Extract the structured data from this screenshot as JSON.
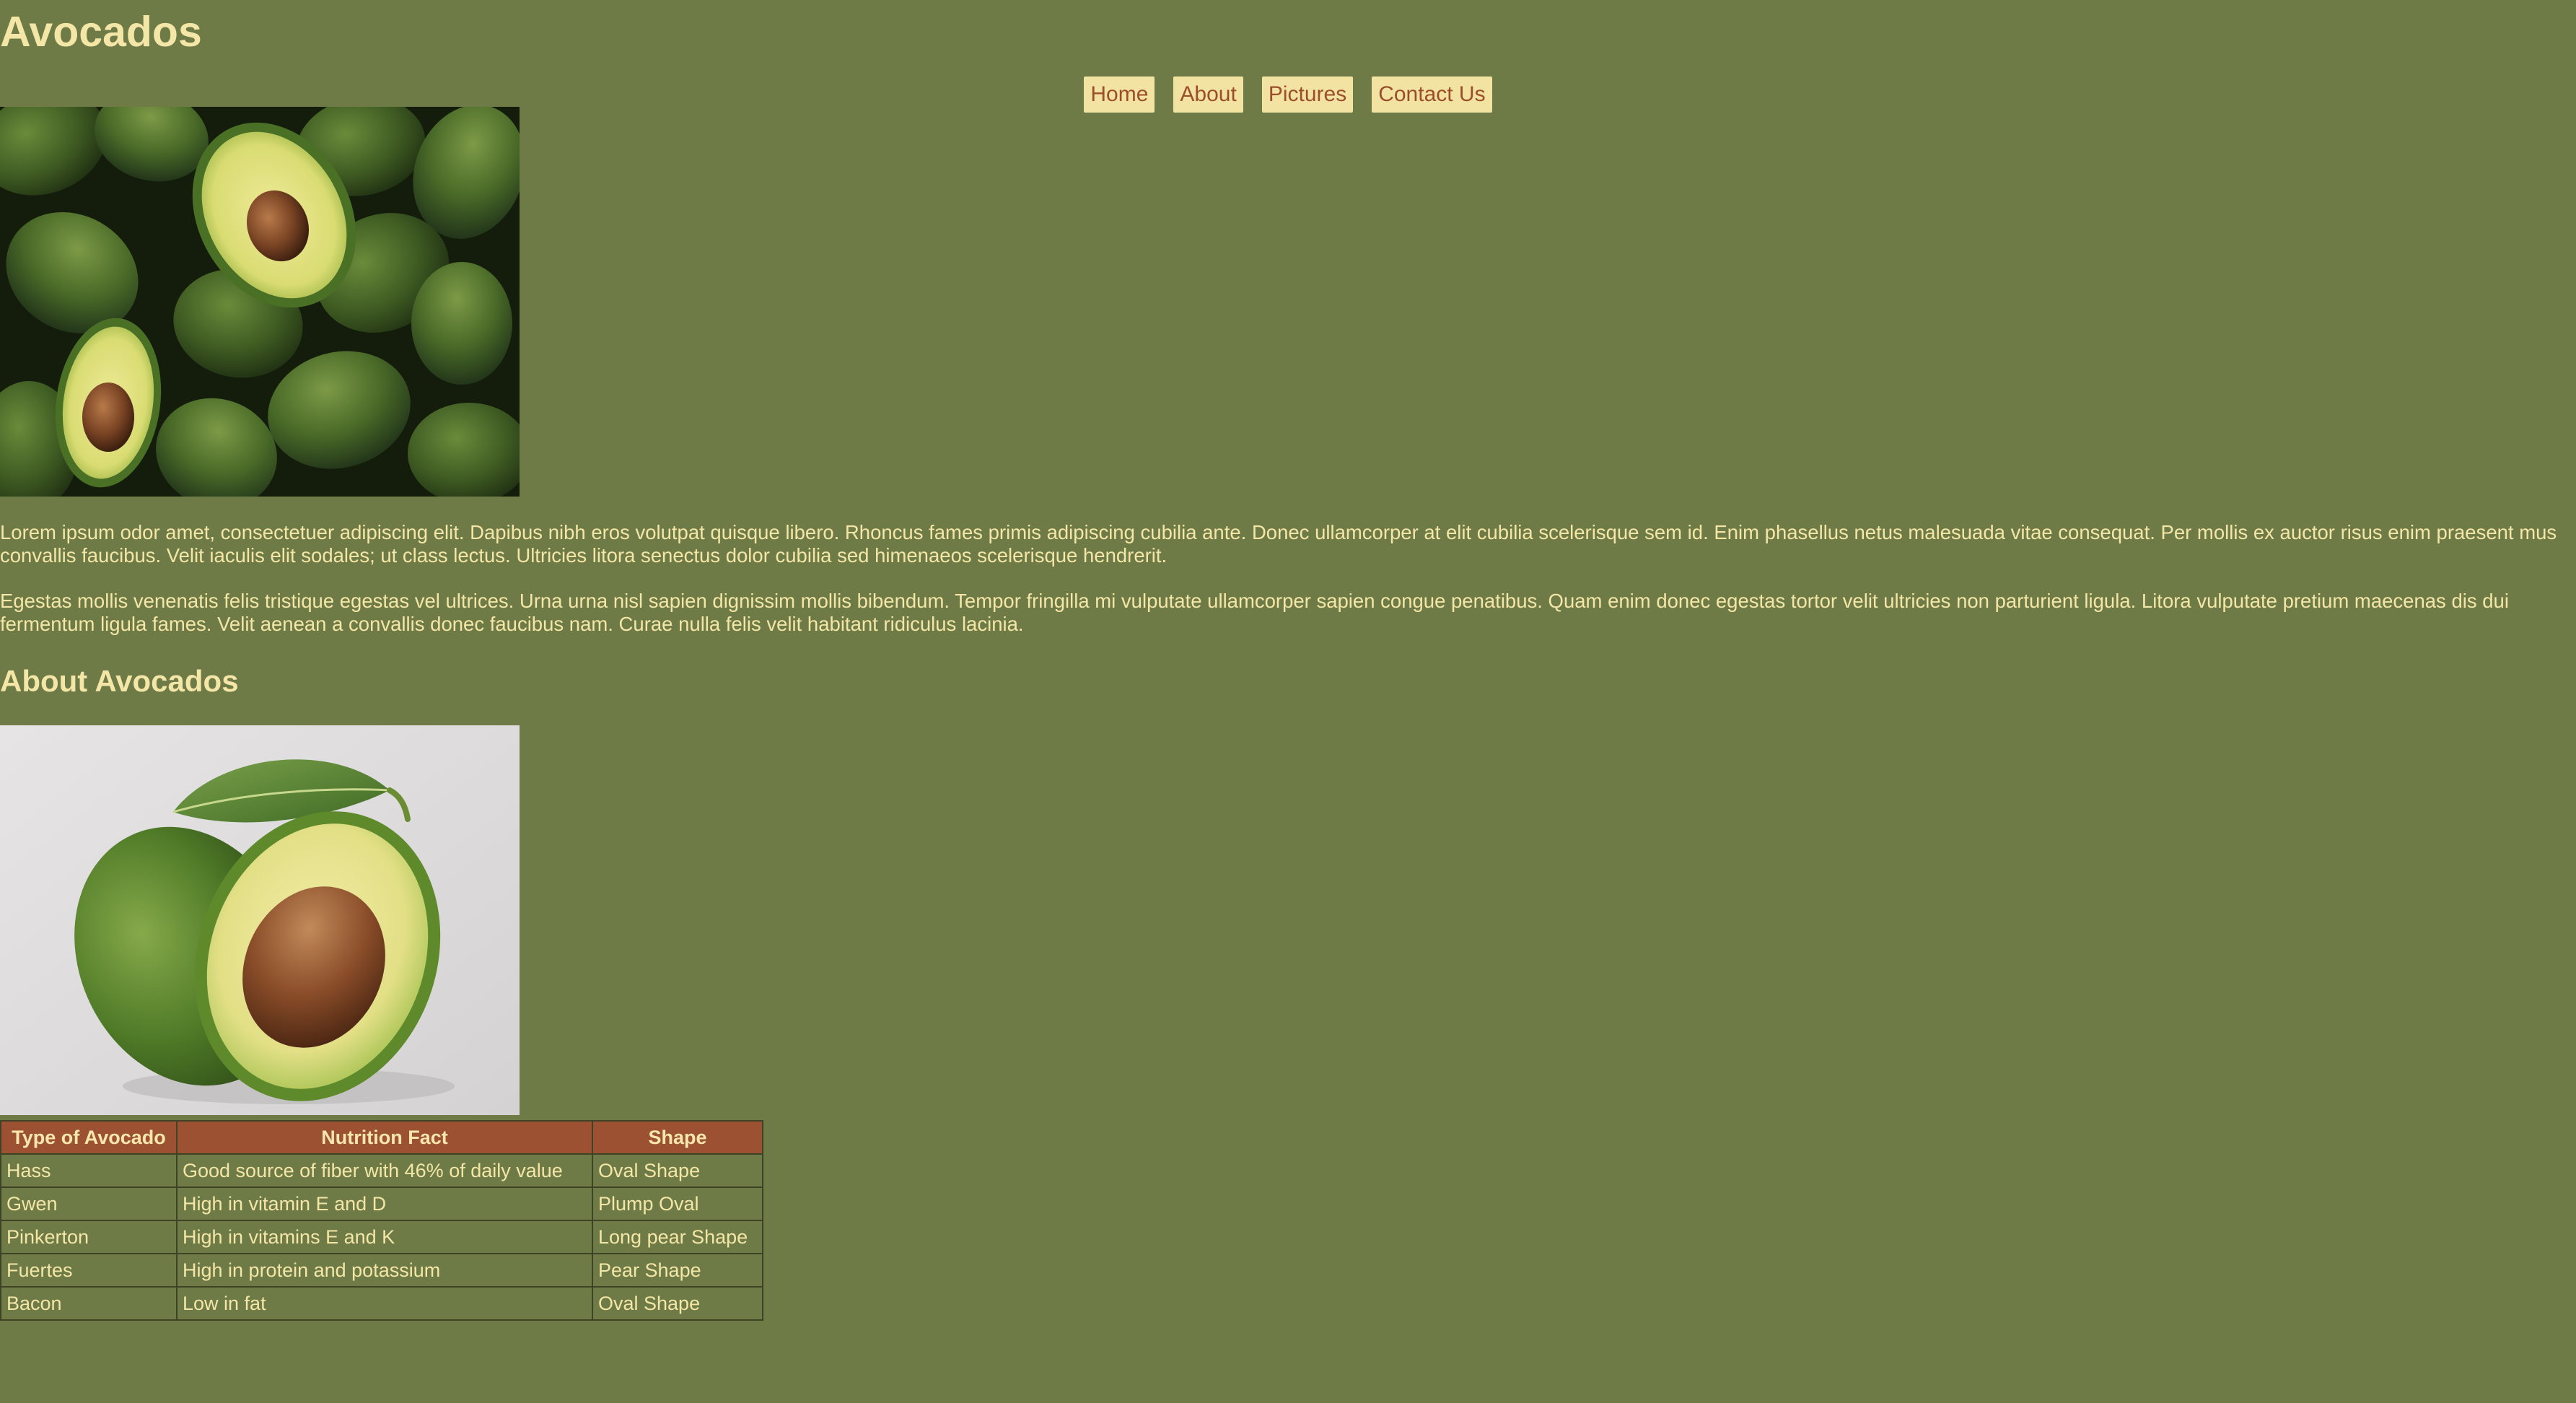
{
  "header": {
    "title": "Avocados"
  },
  "nav": {
    "items": [
      {
        "label": "Home"
      },
      {
        "label": "About"
      },
      {
        "label": "Pictures"
      },
      {
        "label": "Contact Us"
      }
    ]
  },
  "content": {
    "paragraphs": [
      "Lorem ipsum odor amet, consectetuer adipiscing elit. Dapibus nibh eros volutpat quisque libero. Rhoncus fames primis adipiscing cubilia ante. Donec ullamcorper at elit cubilia scelerisque sem id. Enim phasellus netus malesuada vitae consequat. Per mollis ex auctor risus enim praesent mus convallis faucibus. Velit iaculis elit sodales; ut class lectus. Ultricies litora senectus dolor cubilia sed himenaeos scelerisque hendrerit.",
      "Egestas mollis venenatis felis tristique egestas vel ultrices. Urna urna nisl sapien dignissim mollis bibendum. Tempor fringilla mi vulputate ullamcorper sapien congue penatibus. Quam enim donec egestas tortor velit ultricies non parturient ligula. Litora vulputate pretium maecenas dis dui fermentum ligula fames. Velit aenean a convallis donec faucibus nam. Curae nulla felis velit habitant ridiculus lacinia."
    ]
  },
  "about": {
    "heading": "About Avocados"
  },
  "table": {
    "headers": [
      "Type of Avocado",
      "Nutrition Fact",
      "Shape"
    ],
    "rows": [
      [
        "Hass",
        "Good source of fiber with 46% of daily value",
        "Oval Shape"
      ],
      [
        "Gwen",
        "High in vitamin E and D",
        "Plump Oval"
      ],
      [
        "Pinkerton",
        "High in vitamins E and K",
        "Long pear Shape"
      ],
      [
        "Fuertes",
        "High in protein and potassium",
        "Pear Shape"
      ],
      [
        "Bacon",
        "Low in fat",
        "Oval Shape"
      ]
    ]
  },
  "colors": {
    "background": "#6e7b47",
    "text": "#f4e6a6",
    "nav_background": "#f2e3a3",
    "nav_text": "#9c4e2a",
    "table_header": "#9c5232"
  }
}
